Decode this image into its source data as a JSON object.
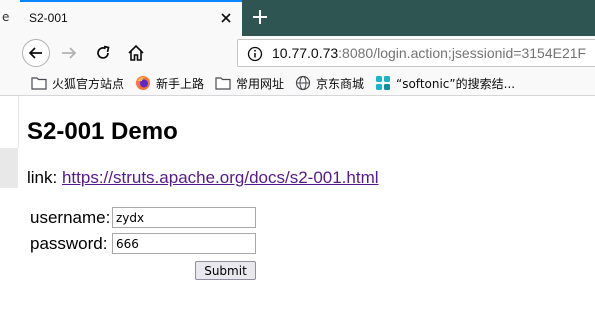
{
  "browser": {
    "left_sliver_text": "e",
    "tab": {
      "title": "S2-001"
    },
    "url": {
      "host": "10.77.0.73",
      "rest": ":8080/login.action;jsessionid=3154E21F"
    },
    "bookmarks": [
      {
        "label": "火狐官方站点",
        "icon": "folder-icon"
      },
      {
        "label": "新手上路",
        "icon": "firefox-icon"
      },
      {
        "label": "常用网址",
        "icon": "folder-icon"
      },
      {
        "label": "京东商城",
        "icon": "globe-icon"
      },
      {
        "label": "“softonic”的搜索结...",
        "icon": "softonic-icon"
      }
    ]
  },
  "page": {
    "title": "S2-001 Demo",
    "link_prefix": "link: ",
    "link_text": "https://struts.apache.org/docs/s2-001.html",
    "form": {
      "username_label": "username:",
      "username_value": "zydx",
      "password_label": "password:",
      "password_value": "666",
      "submit_label": "Submit"
    }
  }
}
